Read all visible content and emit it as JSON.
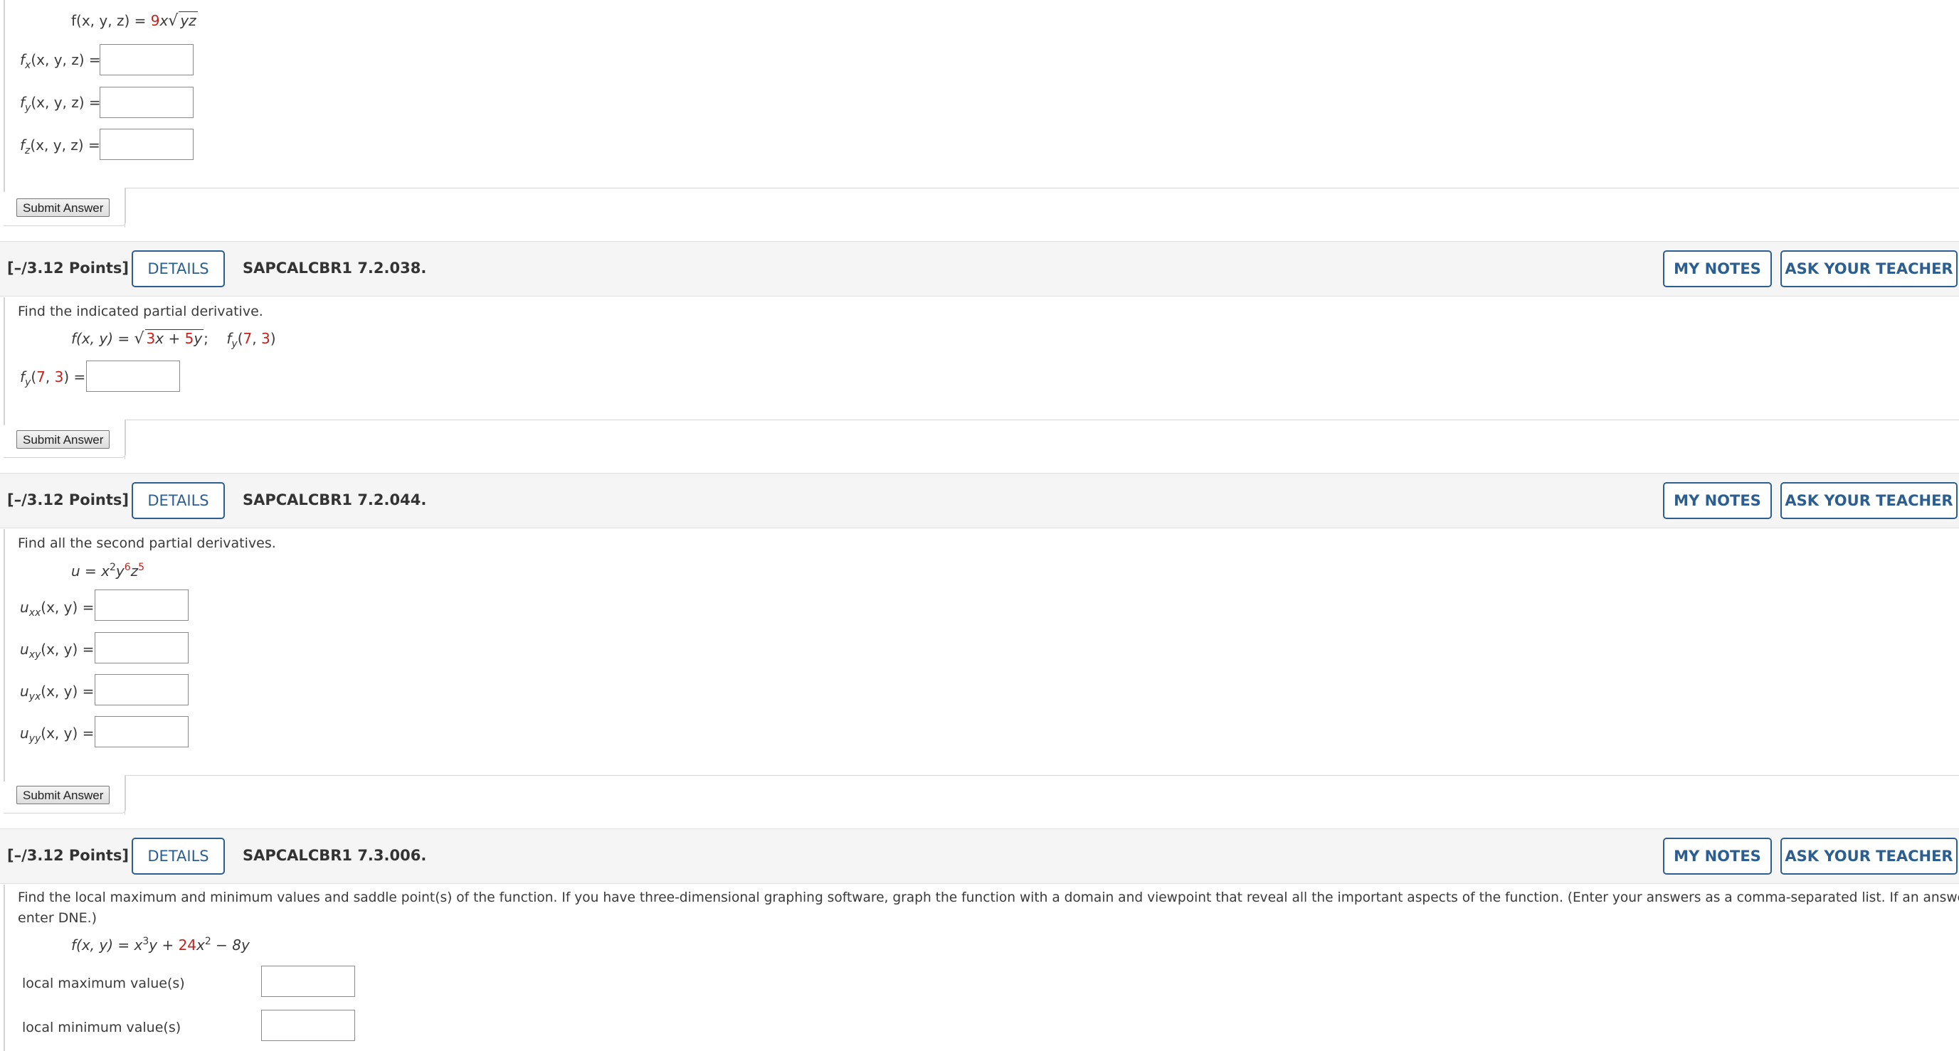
{
  "questions": [
    {
      "id": "q1",
      "formula": {
        "lhs": "f(x, y, z) = ",
        "coef": "9",
        "x": "x",
        "radicand": "yz"
      },
      "answers": [
        {
          "label_f": "f",
          "label_sub": "x",
          "label_rest": "(x, y, z) = ",
          "value": ""
        },
        {
          "label_f": "f",
          "label_sub": "y",
          "label_rest": "(x, y, z) = ",
          "value": ""
        },
        {
          "label_f": "f",
          "label_sub": "z",
          "label_rest": "(x, y, z) = ",
          "value": ""
        }
      ],
      "submit_label": "Submit Answer"
    },
    {
      "id": "q2",
      "header": {
        "points": "[–/3.12 Points]",
        "details": "DETAILS",
        "code": "SAPCALCBR1 7.2.038.",
        "my_notes": "MY NOTES",
        "ask_teacher": "ASK YOUR TEACHER"
      },
      "prompt": "Find the indicated partial derivative.",
      "formula": {
        "lhs": "f(x, y) = ",
        "rad_a": "3",
        "rad_b": "x + ",
        "rad_c": "5",
        "rad_d": "y",
        "semi": ";",
        "target_f": "f",
        "target_sub": "y",
        "target_open": "(",
        "target_x": "7",
        "target_comma": ", ",
        "target_y": "3",
        "target_close": ")"
      },
      "answer": {
        "label_f": "f",
        "label_sub": "y",
        "label_open": "(",
        "x": "7",
        "comma": ", ",
        "y": "3",
        "close": ") = ",
        "value": ""
      },
      "submit_label": "Submit Answer"
    },
    {
      "id": "q3",
      "header": {
        "points": "[–/3.12 Points]",
        "details": "DETAILS",
        "code": "SAPCALCBR1 7.2.044.",
        "my_notes": "MY NOTES",
        "ask_teacher": "ASK YOUR TEACHER"
      },
      "prompt": "Find all the second partial derivatives.",
      "formula": {
        "lhs": "u = x",
        "e1": "2",
        "y": "y",
        "e2": "6",
        "z": "z",
        "e3": "5"
      },
      "answers": [
        {
          "u": "u",
          "sub": "xx",
          "rest": "(x, y) = ",
          "value": ""
        },
        {
          "u": "u",
          "sub": "xy",
          "rest": "(x, y) = ",
          "value": ""
        },
        {
          "u": "u",
          "sub": "yx",
          "rest": "(x, y) = ",
          "value": ""
        },
        {
          "u": "u",
          "sub": "yy",
          "rest": "(x, y) = ",
          "value": ""
        }
      ],
      "submit_label": "Submit Answer"
    },
    {
      "id": "q4",
      "header": {
        "points": "[–/3.12 Points]",
        "details": "DETAILS",
        "code": "SAPCALCBR1 7.3.006.",
        "my_notes": "MY NOTES",
        "ask_teacher": "ASK YOUR TEACHER"
      },
      "prompt_line1": "Find the local maximum and minimum values and saddle point(s) of the function. If you have three-dimensional graphing software, graph the function with a domain and viewpoint that reveal all the important aspects of the function. (Enter your answers as a comma-separated list. If an answer does not exist,",
      "prompt_line2": "enter DNE.)",
      "formula": {
        "lhs": "f(x, y) = x",
        "e1": "3",
        "mid": "y + ",
        "coef": "24",
        "x": "x",
        "e2": "2",
        "tail": " − 8y"
      },
      "answers": [
        {
          "label": "local maximum value(s)",
          "value": ""
        },
        {
          "label": "local minimum value(s)",
          "value": ""
        }
      ]
    }
  ]
}
